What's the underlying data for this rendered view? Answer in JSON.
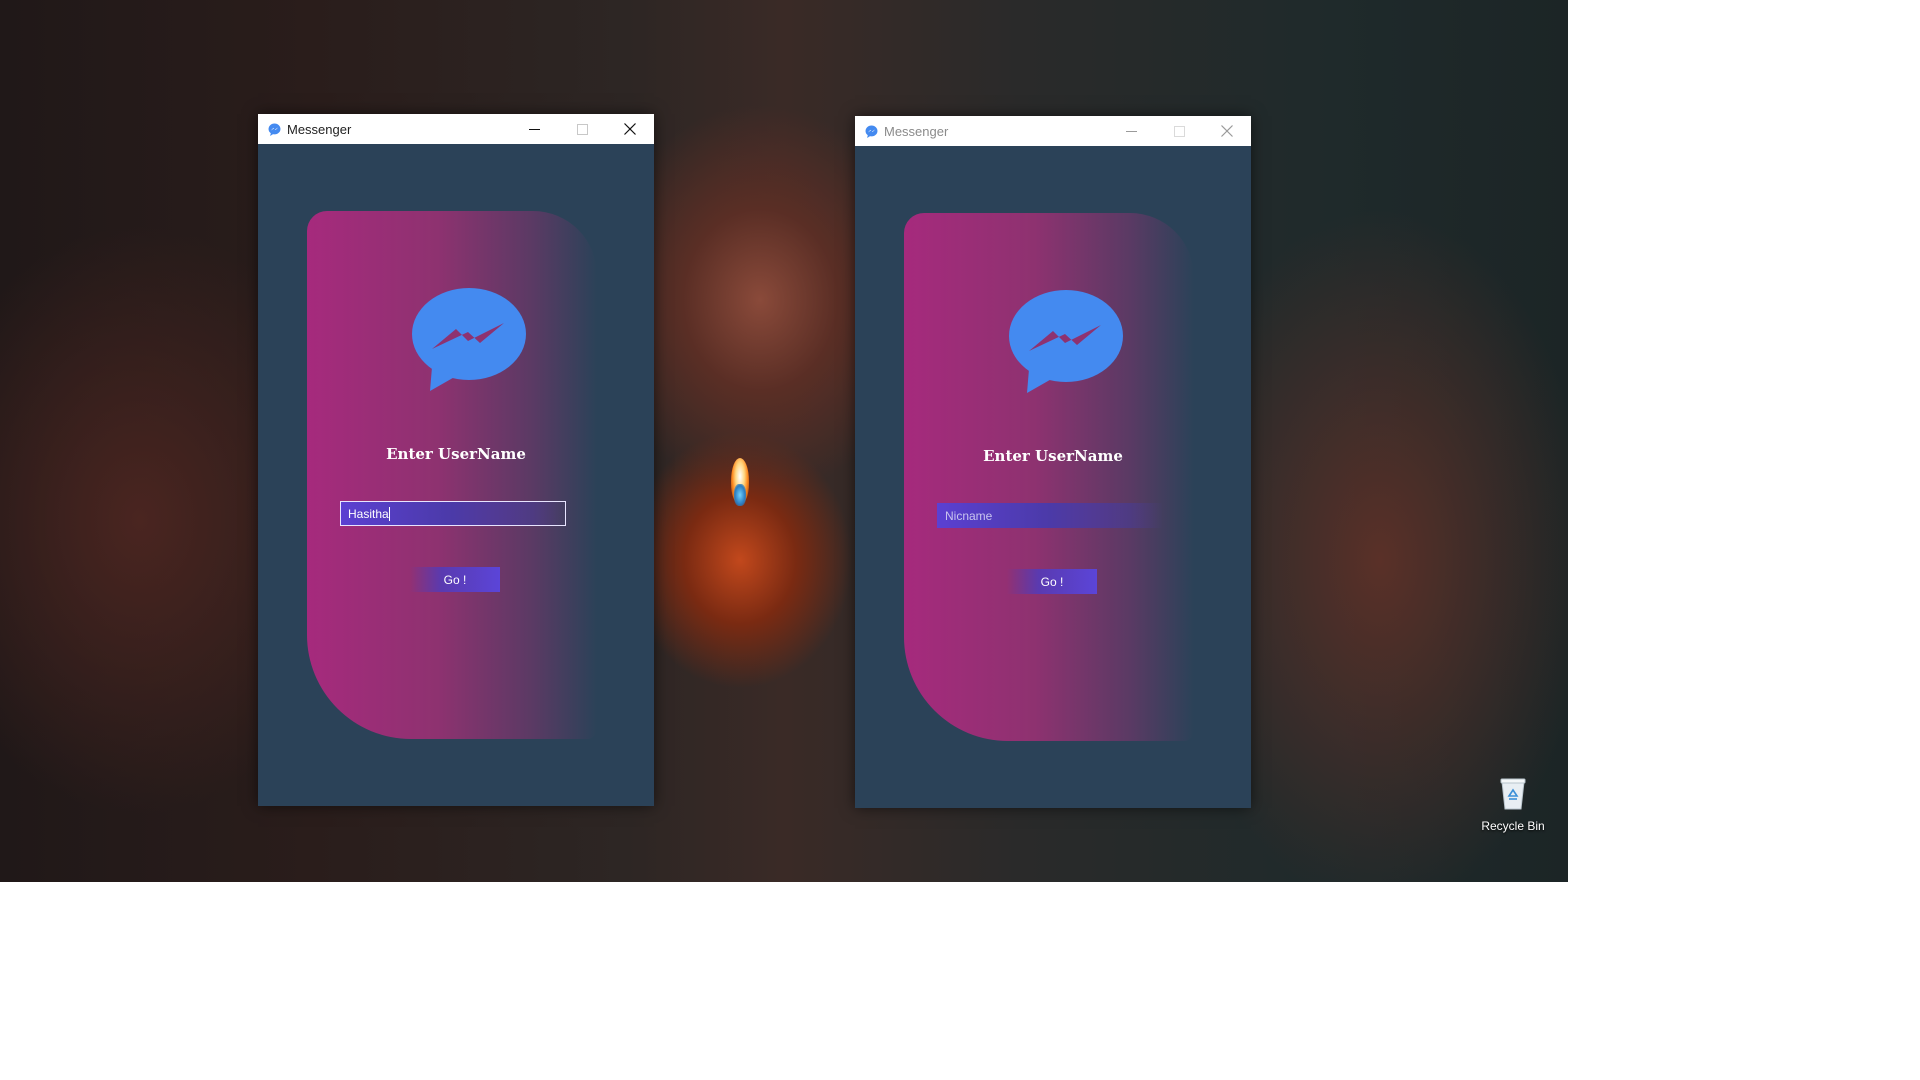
{
  "windows": [
    {
      "title": "Messenger",
      "heading": "Enter UserName",
      "input_value": "Hasitha",
      "input_placeholder": "Nicname",
      "button_label": "Go !",
      "active": true
    },
    {
      "title": "Messenger",
      "heading": "Enter UserName",
      "input_value": "",
      "input_placeholder": "Nicname",
      "button_label": "Go !",
      "active": false
    }
  ],
  "desktop": {
    "recycle_bin_label": "Recycle Bin"
  },
  "colors": {
    "window_bg": "#2b4258",
    "card_gradient_start": "#a62a7d",
    "card_gradient_end": "#5a3a64",
    "logo_blue": "#448af0",
    "input_purple": "#5b40d2"
  },
  "icons": {
    "title_icon": "messenger-icon",
    "logo": "messenger-logo-icon",
    "minimize": "minimize-icon",
    "maximize": "maximize-icon",
    "close": "close-icon",
    "recycle_bin": "recycle-bin-icon"
  }
}
